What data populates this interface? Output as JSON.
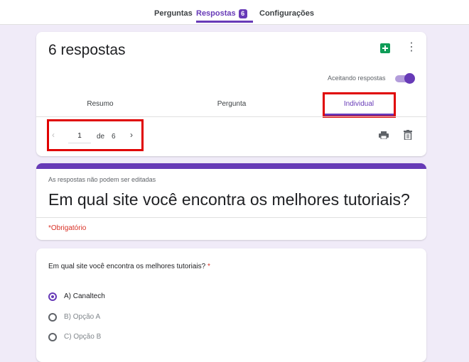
{
  "top_tabs": [
    {
      "label": "Perguntas"
    },
    {
      "label": "Respostas",
      "badge": "6"
    },
    {
      "label": "Configurações"
    }
  ],
  "summary": {
    "response_count": "6 respostas",
    "accepting_label": "Aceitando respostas",
    "accepting_on": true
  },
  "sub_tabs": [
    {
      "label": "Resumo"
    },
    {
      "label": "Pergunta"
    },
    {
      "label": "Individual"
    }
  ],
  "pager": {
    "prev_glyph": "‹",
    "current": "1",
    "of_label": "de",
    "total": "6",
    "next_glyph": "›"
  },
  "form": {
    "readonly_note": "As respostas não podem ser editadas",
    "title": "Em qual site você encontra os melhores tutoriais?",
    "required_note": "*Obrigatório"
  },
  "question": {
    "text": "Em qual site você encontra os melhores tutoriais?",
    "required_mark": "*",
    "options": [
      {
        "label": "A) Canaltech",
        "selected": true
      },
      {
        "label": "B) Opção A",
        "selected": false
      },
      {
        "label": "C) Opção B",
        "selected": false
      }
    ]
  },
  "colors": {
    "accent": "#673ab7",
    "background": "#f0ebf8",
    "highlight": "#e00000",
    "sheets_green": "#0f9d58",
    "required_red": "#d93025"
  },
  "icons": {
    "sheets": "google-sheets-icon",
    "more": "more-vert-icon",
    "print": "print-icon",
    "delete": "trash-icon"
  }
}
